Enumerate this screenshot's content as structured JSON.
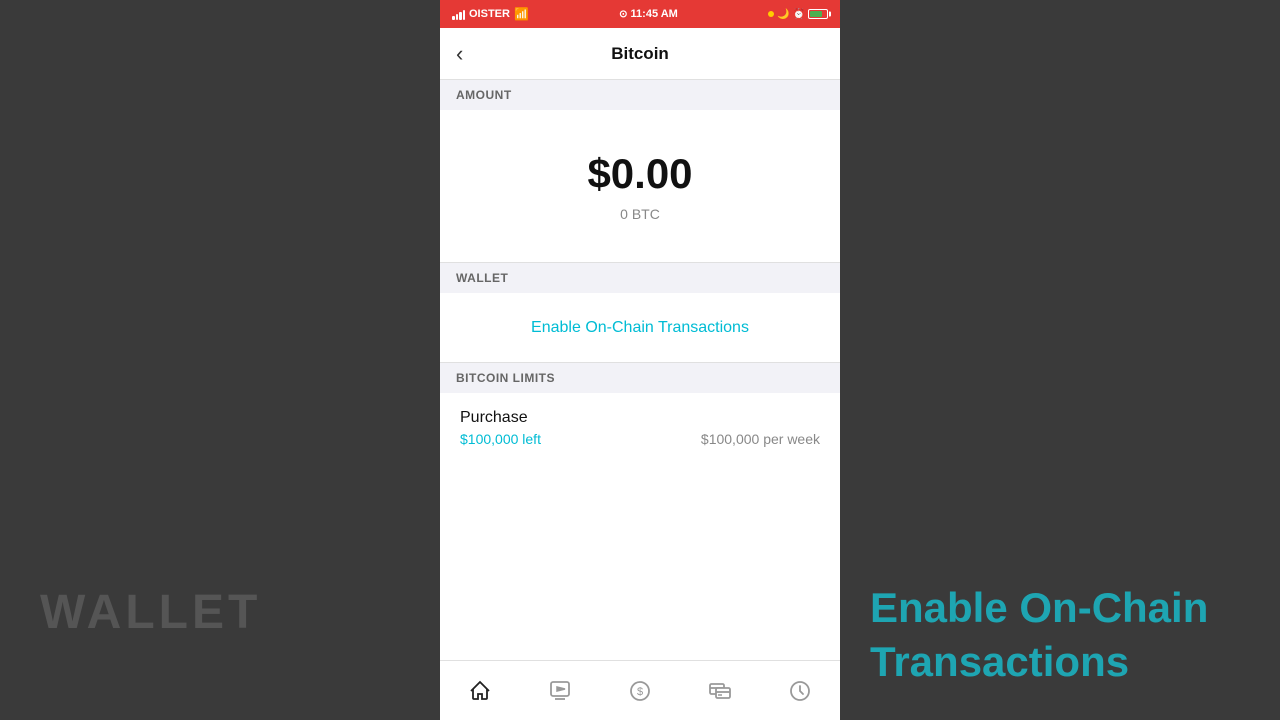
{
  "status_bar": {
    "carrier": "OISTER",
    "time": "11:45 AM",
    "wifi": true,
    "battery_percent": 75
  },
  "header": {
    "back_label": "‹",
    "title": "Bitcoin"
  },
  "sections": {
    "amount_header": "AMOUNT",
    "amount_usd": "$0.00",
    "amount_btc": "0 BTC",
    "wallet_header": "WALLET",
    "enable_link": "Enable On-Chain Transactions",
    "limits_header": "BITCOIN LIMITS",
    "purchase_label": "Purchase",
    "purchase_left": "$100,000 left",
    "purchase_per_week": "$100,000 per week"
  },
  "background": {
    "left_text": "WALLET",
    "right_text": "Enable On-Chain Transactions"
  },
  "bottom_nav": {
    "items": [
      {
        "icon": "home",
        "label": "Home",
        "active": true
      },
      {
        "icon": "play",
        "label": "Activity",
        "active": false
      },
      {
        "icon": "dollar",
        "label": "Cash",
        "active": false
      },
      {
        "icon": "card",
        "label": "Card",
        "active": false
      },
      {
        "icon": "clock",
        "label": "History",
        "active": false
      }
    ]
  }
}
